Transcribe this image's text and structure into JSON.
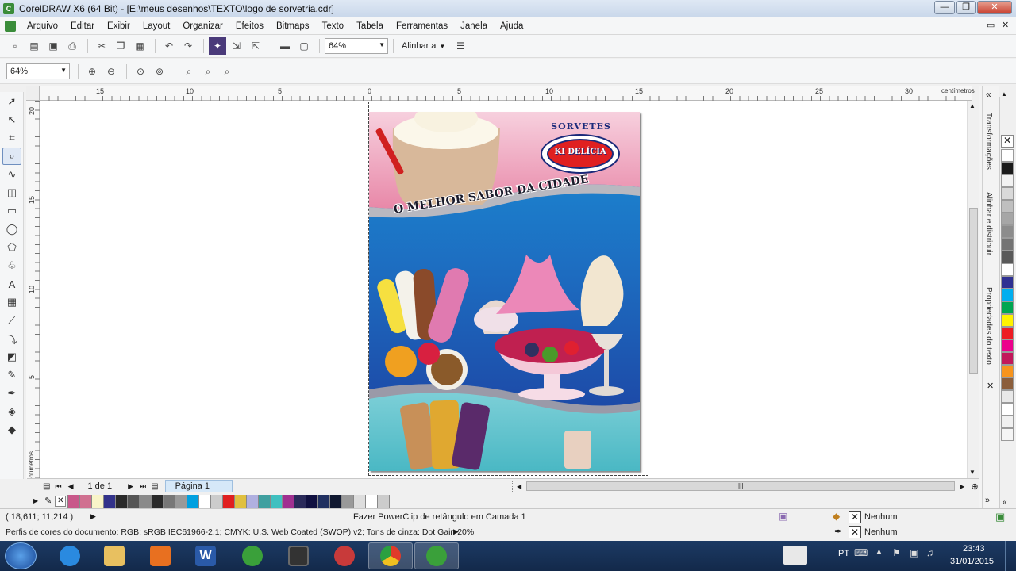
{
  "window": {
    "title": "CorelDRAW X6 (64 Bit) - [E:\\meus desenhos\\TEXTO\\logo de sorvetria.cdr]",
    "minimize": "—",
    "restore": "❐",
    "close": "✕"
  },
  "menu": [
    "Arquivo",
    "Editar",
    "Exibir",
    "Layout",
    "Organizar",
    "Efeitos",
    "Bitmaps",
    "Texto",
    "Tabela",
    "Ferramentas",
    "Janela",
    "Ajuda"
  ],
  "standard_toolbar": {
    "zoom_value": "64%",
    "align_label": "Alinhar a"
  },
  "zoom_toolbar": {
    "zoom_value": "64%"
  },
  "rulers": {
    "unit": "centímetros",
    "h_ticks": [
      "15",
      "10",
      "5",
      "0",
      "5",
      "10",
      "15",
      "20",
      "25",
      "30"
    ],
    "v_ticks": [
      "20",
      "15",
      "10",
      "5"
    ],
    "v_unit": "centímetros"
  },
  "dockers": {
    "tabs": [
      "Transformações",
      "Alinhar e distribuir",
      "Propriedades do texto"
    ]
  },
  "palette": {
    "colors": [
      "#ffffff",
      "#1a1a1a",
      "#f2f2f2",
      "#d9d9d9",
      "#bfbfbf",
      "#a6a6a6",
      "#8c8c8c",
      "#737373",
      "#595959",
      "#ffffff",
      "#2e3092",
      "#00aeef",
      "#00a651",
      "#fff200",
      "#ed1c24",
      "#ec008c",
      "#c2185b",
      "#f7941d",
      "#8b5e3c",
      "#e8e8e8",
      "#ffffff",
      "#f0f0f0",
      "#f5f5f5"
    ]
  },
  "page_nav": {
    "page_count": "1 de 1",
    "page_tab": "Página 1"
  },
  "bottom_palette": {
    "colors": [
      "#c8588a",
      "#d07090",
      "#f8f4c8",
      "#33338a",
      "#2a2a2a",
      "#555555",
      "#8a8a8a",
      "#2a2a2a",
      "#777777",
      "#999999",
      "#00a0e0",
      "#ffffff",
      "#cccccc",
      "#e02020",
      "#e0c040",
      "#b0b0e0",
      "#40a0a0",
      "#40c0c0",
      "#a03090",
      "#2a2a5a",
      "#101040",
      "#203060",
      "#101830",
      "#999999",
      "#dddddd",
      "#ffffff",
      "#cccccc"
    ]
  },
  "status": {
    "coords": "( 18,611; 11,214 )",
    "hint": "Fazer PowerClip de retângulo em Camada 1",
    "color_profile": "Perfis de cores do documento: RGB: sRGB IEC61966-2.1; CMYK: U.S. Web Coated (SWOP) v2; Tons de cinza: Dot Gain 20%",
    "fill_none": "Nenhum",
    "outline_none": "Nenhum"
  },
  "poster": {
    "brand_top": "SORVETES",
    "brand_name": "KI DELÍCIA",
    "tagline": "O MELHOR SABOR DA CIDADE"
  },
  "taskbar": {
    "lang": "PT",
    "time": "23:43",
    "date": "31/01/2015"
  }
}
